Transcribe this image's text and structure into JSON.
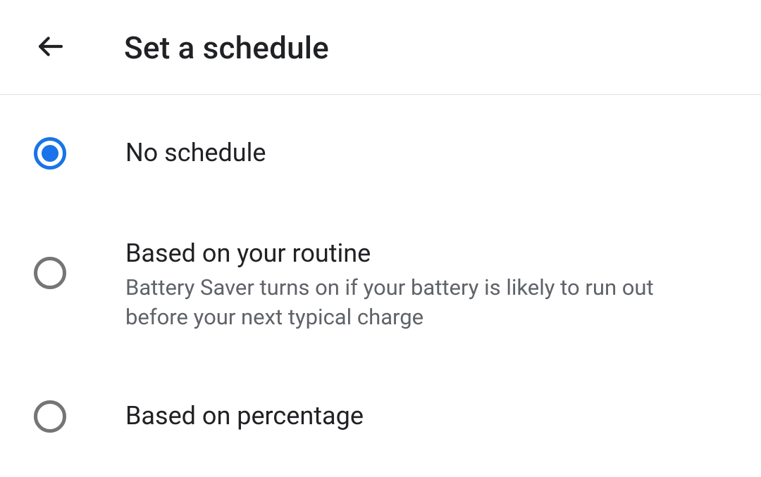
{
  "header": {
    "title": "Set a schedule"
  },
  "options": [
    {
      "label": "No schedule",
      "description": "",
      "selected": true
    },
    {
      "label": "Based on your routine",
      "description": "Battery Saver turns on if your battery is likely to run out before your next typical charge",
      "selected": false
    },
    {
      "label": "Based on percentage",
      "description": "",
      "selected": false
    }
  ]
}
